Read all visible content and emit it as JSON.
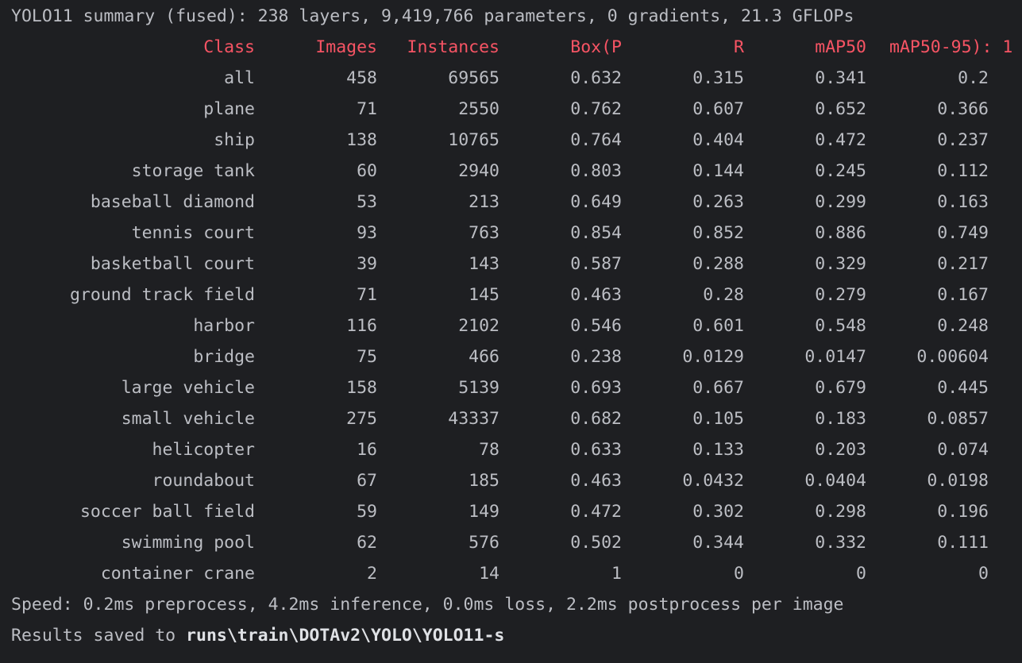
{
  "summary_line": "YOLO11 summary (fused): 238 layers, 9,419,766 parameters, 0 gradients, 21.3 GFLOPs",
  "colors": {
    "background": "#1e1f22",
    "text": "#bcbec4",
    "header": "#f75464"
  },
  "table": {
    "headers": [
      "Class",
      "Images",
      "Instances",
      "Box(P",
      "R",
      "mAP50",
      "mAP50-95): 1"
    ],
    "rows": [
      [
        "all",
        "458",
        "69565",
        "0.632",
        "0.315",
        "0.341",
        "0.2"
      ],
      [
        "plane",
        "71",
        "2550",
        "0.762",
        "0.607",
        "0.652",
        "0.366"
      ],
      [
        "ship",
        "138",
        "10765",
        "0.764",
        "0.404",
        "0.472",
        "0.237"
      ],
      [
        "storage tank",
        "60",
        "2940",
        "0.803",
        "0.144",
        "0.245",
        "0.112"
      ],
      [
        "baseball diamond",
        "53",
        "213",
        "0.649",
        "0.263",
        "0.299",
        "0.163"
      ],
      [
        "tennis court",
        "93",
        "763",
        "0.854",
        "0.852",
        "0.886",
        "0.749"
      ],
      [
        "basketball court",
        "39",
        "143",
        "0.587",
        "0.288",
        "0.329",
        "0.217"
      ],
      [
        "ground track field",
        "71",
        "145",
        "0.463",
        "0.28",
        "0.279",
        "0.167"
      ],
      [
        "harbor",
        "116",
        "2102",
        "0.546",
        "0.601",
        "0.548",
        "0.248"
      ],
      [
        "bridge",
        "75",
        "466",
        "0.238",
        "0.0129",
        "0.0147",
        "0.00604"
      ],
      [
        "large vehicle",
        "158",
        "5139",
        "0.693",
        "0.667",
        "0.679",
        "0.445"
      ],
      [
        "small vehicle",
        "275",
        "43337",
        "0.682",
        "0.105",
        "0.183",
        "0.0857"
      ],
      [
        "helicopter",
        "16",
        "78",
        "0.633",
        "0.133",
        "0.203",
        "0.074"
      ],
      [
        "roundabout",
        "67",
        "185",
        "0.463",
        "0.0432",
        "0.0404",
        "0.0198"
      ],
      [
        "soccer ball field",
        "59",
        "149",
        "0.472",
        "0.302",
        "0.298",
        "0.196"
      ],
      [
        "swimming pool",
        "62",
        "576",
        "0.502",
        "0.344",
        "0.332",
        "0.111"
      ],
      [
        "container crane",
        "2",
        "14",
        "1",
        "0",
        "0",
        "0"
      ]
    ]
  },
  "speed_line": "Speed: 0.2ms preprocess, 4.2ms inference, 0.0ms loss, 2.2ms postprocess per image",
  "results": {
    "prefix": "Results saved to ",
    "path": "runs\\train\\DOTAv2\\YOLO\\YOLO11-s"
  }
}
